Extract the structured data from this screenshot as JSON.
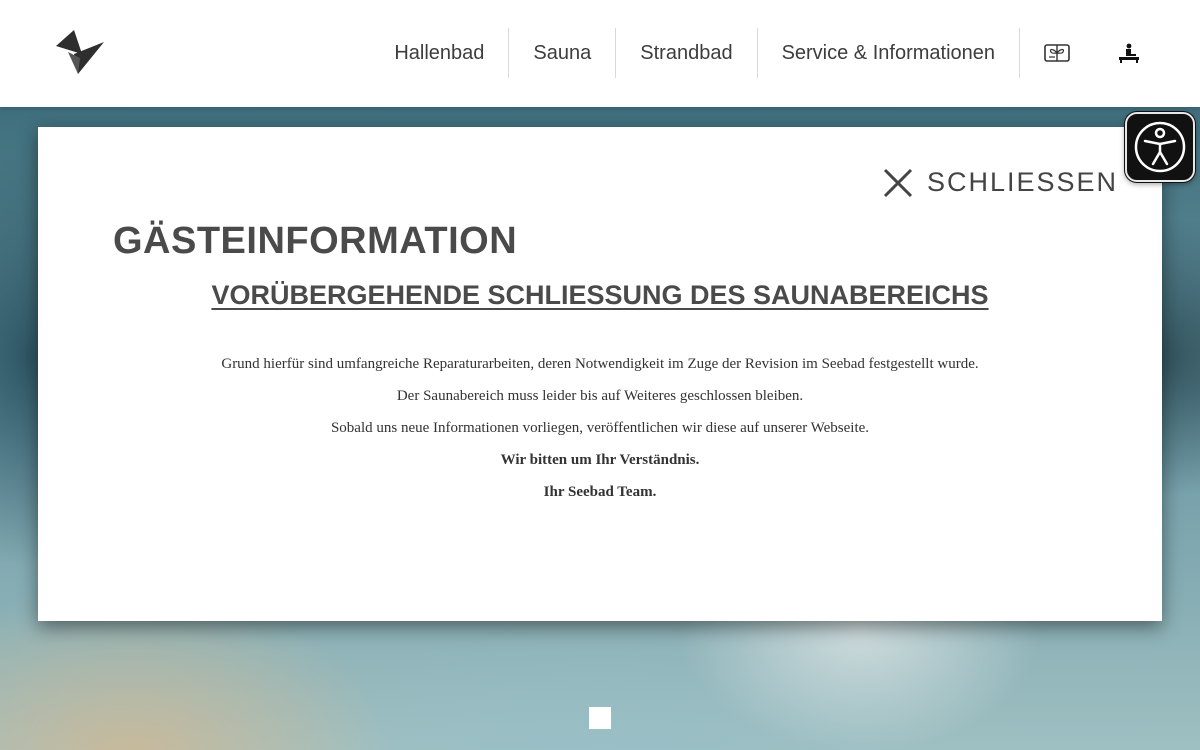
{
  "header": {
    "nav": [
      {
        "label": "Hallenbad"
      },
      {
        "label": "Sauna"
      },
      {
        "label": "Strandbad"
      },
      {
        "label": "Service & Informationen"
      }
    ],
    "icons": [
      "voucher-icon",
      "massage-icon"
    ]
  },
  "modal": {
    "close_label": "SCHLIESSEN",
    "heading": "GÄSTEINFORMATION",
    "subheading": "VORÜBERGEHENDE SCHLIESSUNG DES SAUNABEREICHS ",
    "paragraphs": [
      "Grund hierfür sind umfangreiche Reparaturarbeiten, deren Notwendigkeit im Zuge der Revision im Seebad festgestellt wurde.",
      "Der Saunabereich muss leider bis auf Weiteres geschlossen bleiben.",
      "Sobald uns neue Informationen vorliegen, veröffentlichen wir diese auf unserer Webseite.",
      "Wir bitten um Ihr Verständnis.",
      "Ihr Seebad Team."
    ]
  },
  "accessibility": {
    "icon": "accessibility-icon"
  },
  "colors": {
    "text": "#444444",
    "accent_dark": "#111111",
    "background": "#ffffff"
  }
}
